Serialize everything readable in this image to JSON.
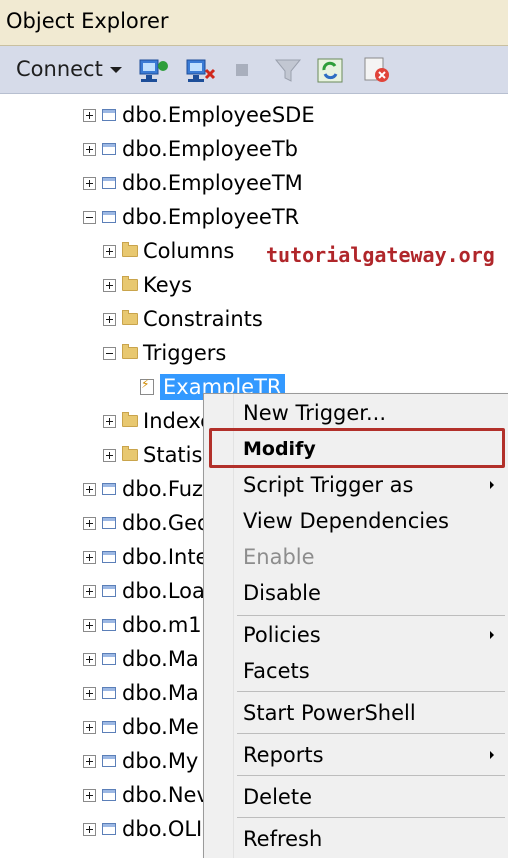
{
  "window": {
    "title": "Object Explorer"
  },
  "toolbar": {
    "connect_label": "Connect",
    "icons": [
      "connect-server-icon",
      "disconnect-server-icon",
      "stop-icon",
      "filter-icon",
      "refresh-icon",
      "summary-icon"
    ]
  },
  "tree": {
    "tables_above": [
      "dbo.EmployeeSDE",
      "dbo.EmployeeTb",
      "dbo.EmployeeTM",
      "dbo.EmployeeTR"
    ],
    "expanded_folders": [
      "Columns",
      "Keys",
      "Constraints",
      "Triggers"
    ],
    "trigger_item": "ExampleTR",
    "folders_below": [
      "Indexe",
      "Statist"
    ],
    "tables_below": [
      "dbo.Fuz",
      "dbo.Geo",
      "dbo.Inte",
      "dbo.Loa",
      "dbo.m1",
      "dbo.Ma",
      "dbo.Ma",
      "dbo.Me",
      "dbo.My",
      "dbo.Nev",
      "dbo.OLI"
    ]
  },
  "watermark": "tutorialgateway.org",
  "context_menu": {
    "items": [
      "New Trigger...",
      "Modify",
      "Script Trigger as",
      "View Dependencies",
      "Enable",
      "Disable",
      "Policies",
      "Facets",
      "Start PowerShell",
      "Reports",
      "Delete",
      "Refresh"
    ],
    "highlighted": "Modify",
    "disabled": [
      "Enable"
    ],
    "with_submenu": [
      "Script Trigger as",
      "Policies",
      "Reports"
    ]
  },
  "colors": {
    "selection": "#3399ff",
    "highlight_box": "#b2302a",
    "watermark": "#b0262a"
  }
}
